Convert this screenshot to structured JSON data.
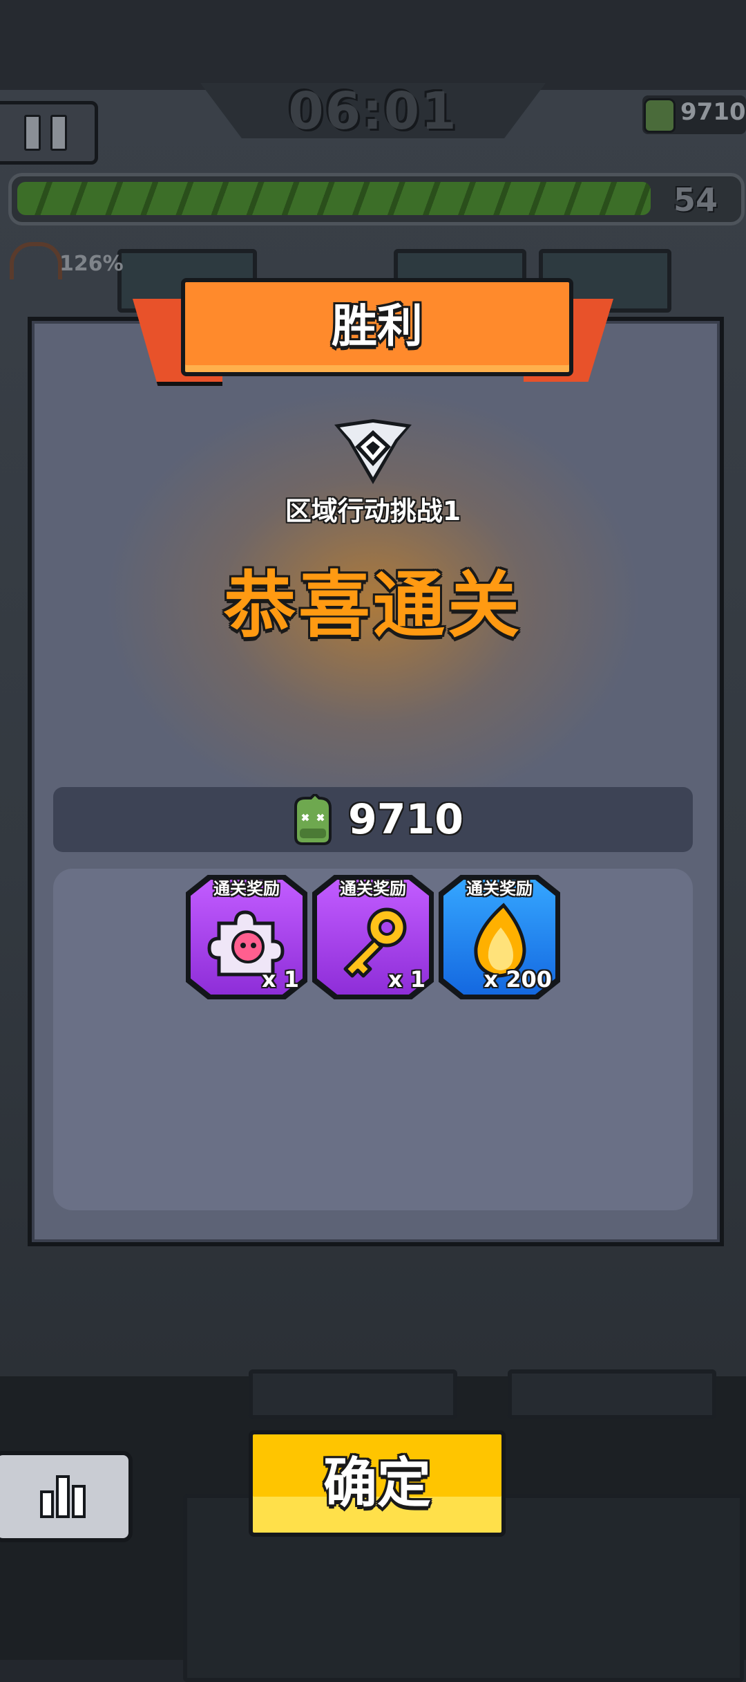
{
  "hud": {
    "timer": "06:01",
    "currency": "9710",
    "level": "54",
    "xp_progress": 0.89,
    "gauge_percent": "126%"
  },
  "dialog": {
    "title": "胜利",
    "stage_name": "区域行动挑战1",
    "clear_message": "恭喜通关",
    "reward_currency": "9710",
    "rewards": [
      {
        "label": "通关奖励",
        "quantity": "x 1",
        "icon": "puzzle-piece-icon",
        "rarity_color": "#a845f0"
      },
      {
        "label": "通关奖励",
        "quantity": "x 1",
        "icon": "golden-key-icon",
        "rarity_color": "#a845f0"
      },
      {
        "label": "通关奖励",
        "quantity": "x 200",
        "icon": "flame-icon",
        "rarity_color": "#1f86f0"
      }
    ]
  },
  "buttons": {
    "confirm": "确定",
    "stats_icon": "bar-chart-icon"
  },
  "colors": {
    "ribbon": "#ff8a2c",
    "clear_title": "#ff9a12",
    "confirm_button": "#ffc500",
    "dialog_bg": "#5d6376"
  }
}
